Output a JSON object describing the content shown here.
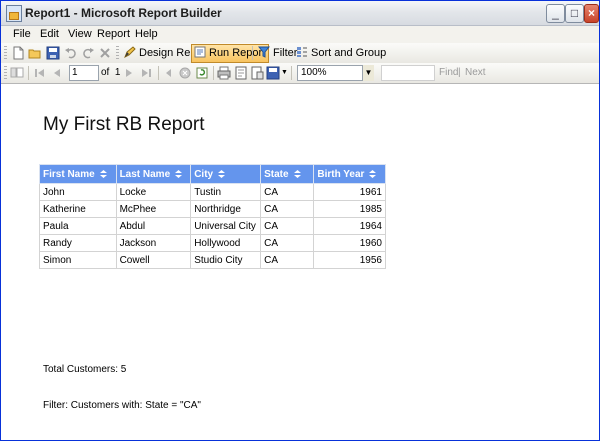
{
  "window": {
    "title": "Report1 - Microsoft Report Builder"
  },
  "menu": [
    "File",
    "Edit",
    "View",
    "Report",
    "Help"
  ],
  "toolbar": {
    "design_report": "Design Report",
    "run_report": "Run Report",
    "filter": "Filter",
    "sort_and_group": "Sort and Group"
  },
  "navigation": {
    "current_page": "1",
    "of_label": "of",
    "total_pages": "1",
    "zoom": "100%",
    "find_label": "Find",
    "next_label": "Next",
    "separator": "|"
  },
  "report": {
    "title": "My First RB Report",
    "columns": [
      "First Name",
      "Last Name",
      "City",
      "State",
      "Birth Year"
    ],
    "rows": [
      [
        "John",
        "Locke",
        "Tustin",
        "CA",
        "1961"
      ],
      [
        "Katherine",
        "McPhee",
        "Northridge",
        "CA",
        "1985"
      ],
      [
        "Paula",
        "Abdul",
        "Universal City",
        "CA",
        "1964"
      ],
      [
        "Randy",
        "Jackson",
        "Hollywood",
        "CA",
        "1960"
      ],
      [
        "Simon",
        "Cowell",
        "Studio City",
        "CA",
        "1956"
      ]
    ],
    "total": "Total Customers: 5",
    "filter": "Filter: Customers with: State = \"CA\""
  },
  "colors": {
    "header_bg": "#6495ed",
    "title_bar": "#0831d9"
  }
}
